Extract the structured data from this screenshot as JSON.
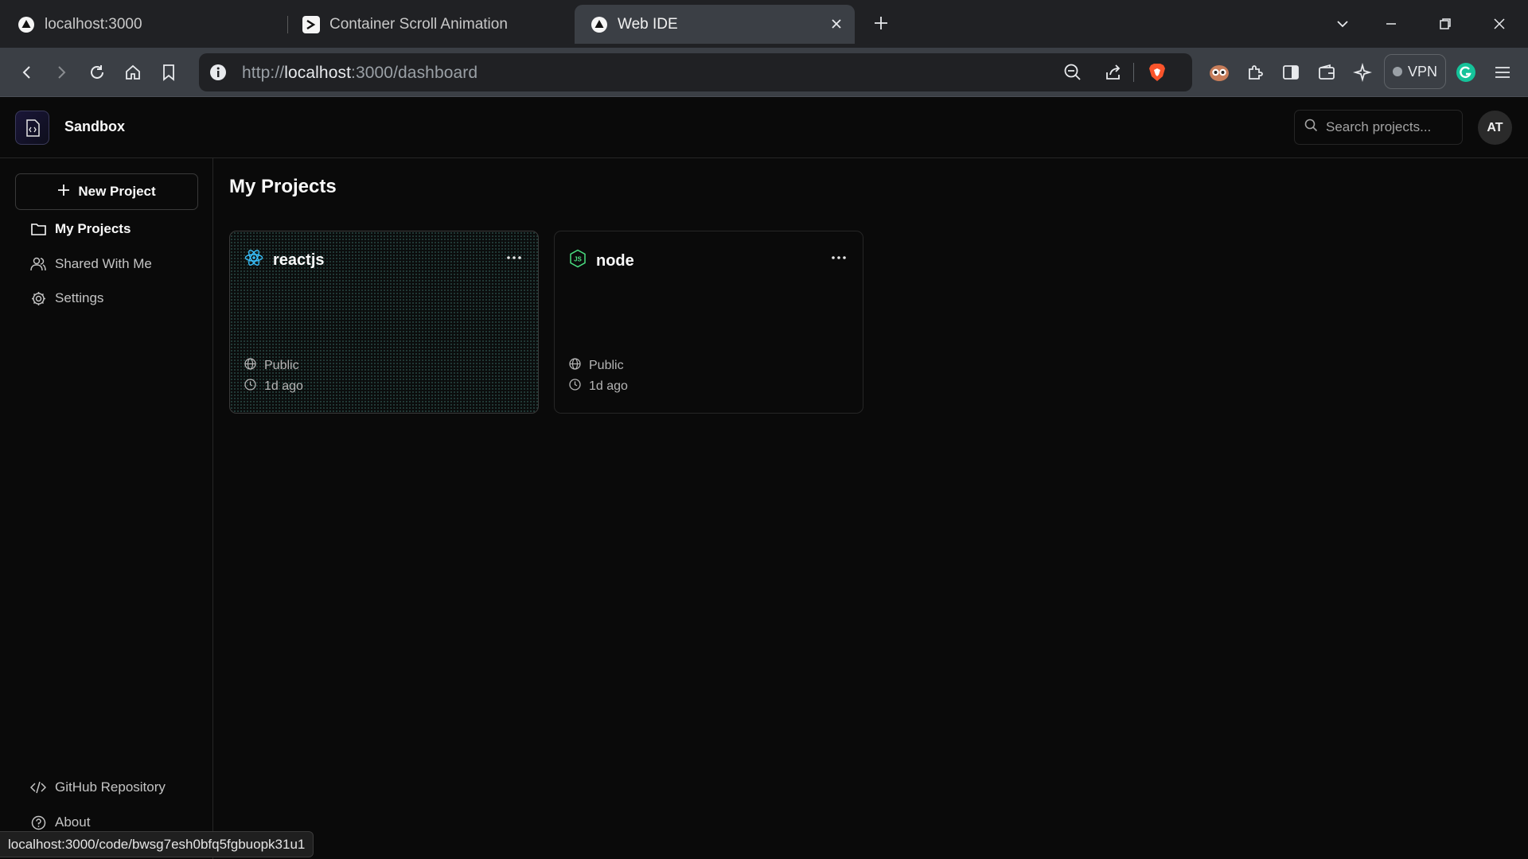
{
  "browser": {
    "tabs": [
      {
        "title": "localhost:3000",
        "icon": "triangle-logo-icon"
      },
      {
        "title": "Container Scroll Animation",
        "icon": "terminal-logo-icon"
      },
      {
        "title": "Web IDE",
        "icon": "triangle-logo-icon",
        "active": true
      }
    ],
    "url_prefix": "http://",
    "url_host": "localhost",
    "url_path": ":3000/dashboard",
    "vpn_label": "VPN"
  },
  "app": {
    "brand": "Sandbox",
    "search_placeholder": "Search projects...",
    "avatar_initials": "AT"
  },
  "sidebar": {
    "new_project": "New Project",
    "items": [
      {
        "label": "My Projects",
        "icon": "folder-icon",
        "active": true
      },
      {
        "label": "Shared With Me",
        "icon": "users-icon"
      },
      {
        "label": "Settings",
        "icon": "gear-icon"
      }
    ],
    "footer": [
      {
        "label": "GitHub Repository",
        "icon": "code-icon"
      },
      {
        "label": "About",
        "icon": "help-circle-icon"
      }
    ]
  },
  "main": {
    "title": "My Projects",
    "projects": [
      {
        "name": "reactjs",
        "icon": "react-icon",
        "visibility": "Public",
        "updated": "1d ago"
      },
      {
        "name": "node",
        "icon": "nodejs-icon",
        "visibility": "Public",
        "updated": "1d ago"
      }
    ]
  },
  "status_url": "localhost:3000/code/bwsg7esh0bfq5fgbuopk31u1",
  "colors": {
    "background": "#0a0a0a",
    "border": "#262626",
    "react": "#38bdf8",
    "node": "#4ade80"
  }
}
